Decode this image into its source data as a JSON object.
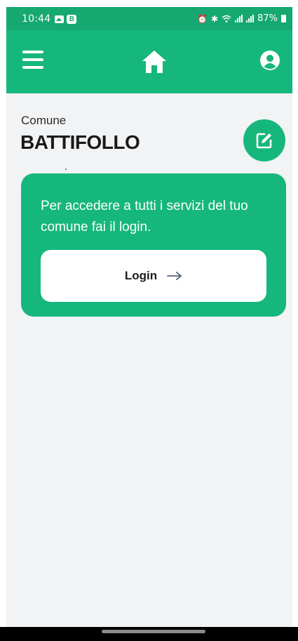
{
  "status_bar": {
    "time": "10:44",
    "battery": "87%",
    "left_icons": [
      "gallery-icon",
      "b-app-icon"
    ],
    "right_icons": [
      "alarm-icon",
      "bluetooth-icon",
      "wifi-icon",
      "signal-icon",
      "signal-icon",
      "battery-icon"
    ]
  },
  "app_bar": {
    "menu_icon": "hamburger-icon",
    "home_icon": "home-icon",
    "profile_icon": "user-icon",
    "color": "#16b77c"
  },
  "header": {
    "label": "Comune",
    "name": "BATTIFOLLO",
    "edit_icon": "edit-icon"
  },
  "login_card": {
    "message": "Per accedere a tutti i servizi del tuo comune fai il login.",
    "button_label": "Login",
    "button_icon": "arrow-right-icon"
  },
  "colors": {
    "accent": "#16b77c",
    "background": "#f2f3f5"
  }
}
